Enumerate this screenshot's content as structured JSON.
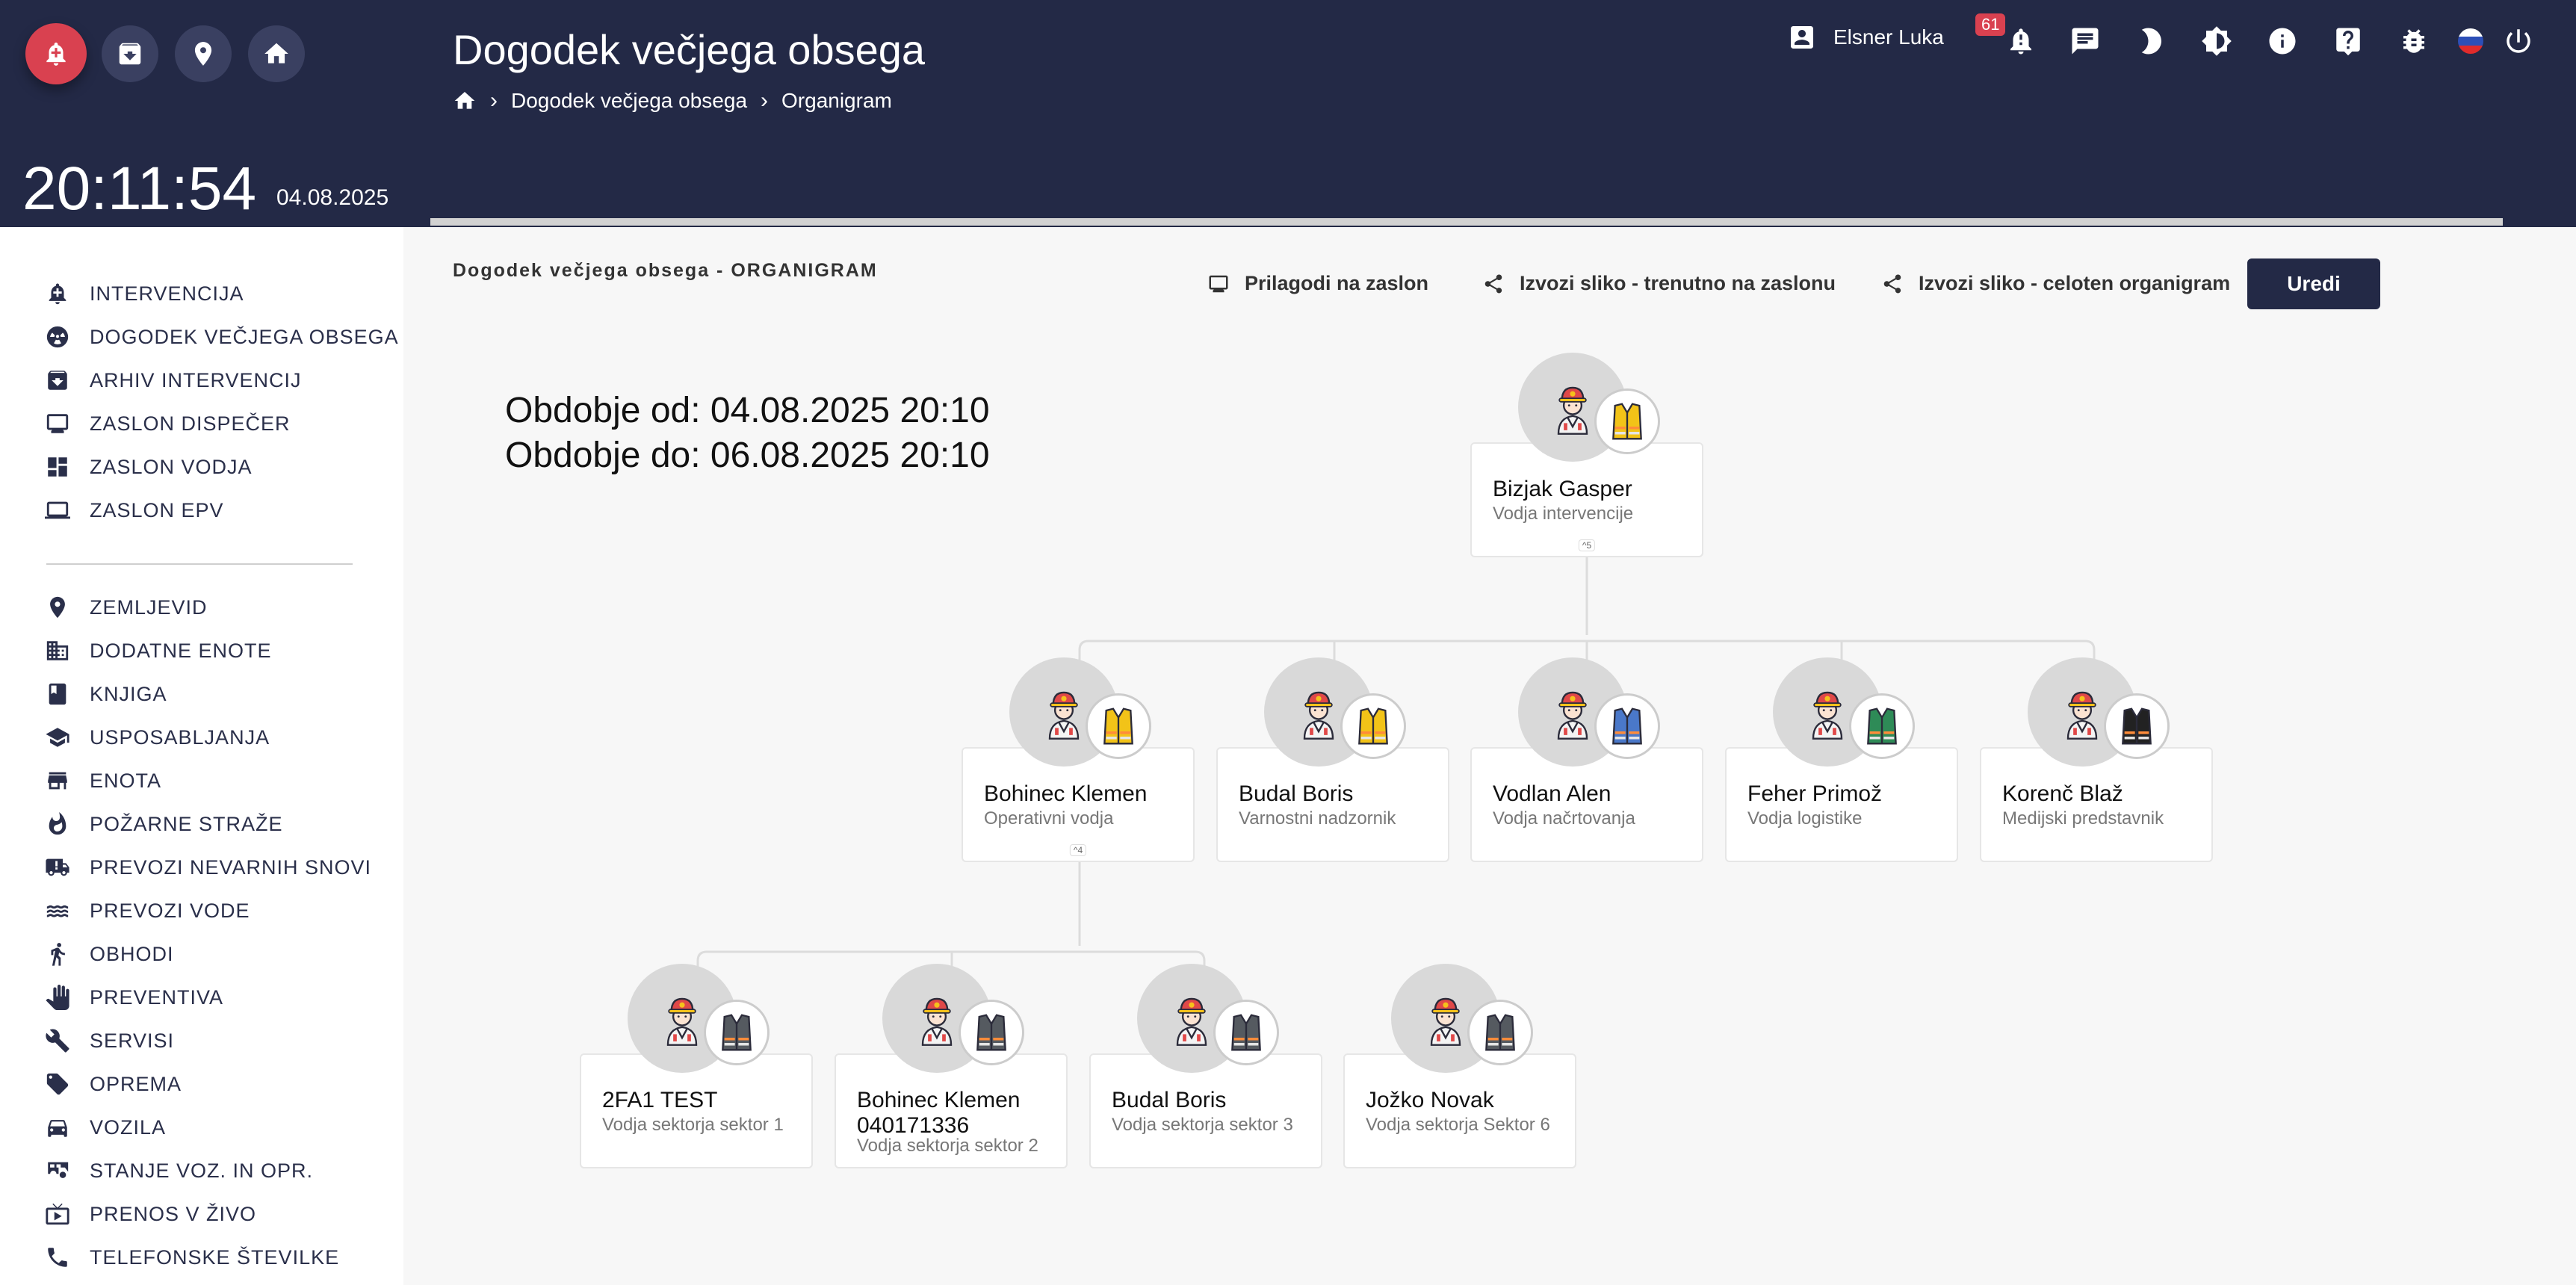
{
  "header": {
    "title": "Dogodek večjega obsega",
    "breadcrumb": [
      "Dogodek večjega obsega",
      "Organigram"
    ],
    "clock": "20:11:54",
    "date": "04.08.2025",
    "user_name": "Elsner Luka",
    "notification_count": "61",
    "top_buttons": [
      "alarm-add-icon",
      "archive-icon",
      "location-icon",
      "home-icon"
    ],
    "top_icons": [
      "bell-icon",
      "chat-icon",
      "dark-mode-icon",
      "brightness-icon",
      "info-icon",
      "help-icon",
      "bug-icon",
      "slovenian-flag-icon",
      "power-icon"
    ]
  },
  "sidebar": {
    "items": [
      {
        "label": "INTERVENCIJA",
        "icon": "bell-plus-icon"
      },
      {
        "label": "DOGODEK VEČJEGA OBSEGA",
        "icon": "radioactive-icon"
      },
      {
        "label": "ARHIV INTERVENCIJ",
        "icon": "archive-icon"
      },
      {
        "label": "ZASLON DISPEČER",
        "icon": "monitor-icon"
      },
      {
        "label": "ZASLON VODJA",
        "icon": "dashboard-icon"
      },
      {
        "label": "ZASLON EPV",
        "icon": "laptop-icon"
      },
      {
        "label": "ZEMLJEVID",
        "icon": "location-icon"
      },
      {
        "label": "DODATNE ENOTE",
        "icon": "building-icon"
      },
      {
        "label": "KNJIGA",
        "icon": "book-icon"
      },
      {
        "label": "USPOSABLJANJA",
        "icon": "school-icon"
      },
      {
        "label": "ENOTA",
        "icon": "store-icon"
      },
      {
        "label": "POŽARNE STRAŽE",
        "icon": "fire-icon"
      },
      {
        "label": "PREVOZI NEVARNIH SNOVI",
        "icon": "truck-alert-icon"
      },
      {
        "label": "PREVOZI VODE",
        "icon": "water-waves-icon"
      },
      {
        "label": "OBHODI",
        "icon": "walk-icon"
      },
      {
        "label": "PREVENTIVA",
        "icon": "hand-icon"
      },
      {
        "label": "SERVISI",
        "icon": "wrench-icon"
      },
      {
        "label": "OPREMA",
        "icon": "tag-icon"
      },
      {
        "label": "VOZILA",
        "icon": "car-icon"
      },
      {
        "label": "STANJE VOZ. IN OPR.",
        "icon": "rv-icon"
      },
      {
        "label": "PRENOS V ŽIVO",
        "icon": "live-tv-icon"
      },
      {
        "label": "TELEFONSKE ŠTEVILKE",
        "icon": "phone-icon"
      }
    ]
  },
  "main": {
    "section_title": "Dogodek večjega obsega - ORGANIGRAM",
    "tools": [
      "Prilagodi na zaslon",
      "Izvozi sliko - trenutno na zaslonu",
      "Izvozi sliko - celoten organigram"
    ],
    "edit_label": "Uredi",
    "period_from": "Obdobje od: 04.08.2025 20:10",
    "period_to": "Obdobje do: 06.08.2025 20:10"
  },
  "org": {
    "root": {
      "name": "Bizjak Gasper",
      "role": "Vodja intervencije",
      "children_count": "5",
      "vest_color": "#f2c318"
    },
    "level2": [
      {
        "name": "Bohinec Klemen",
        "role": "Operativni vodja",
        "children_count": "4",
        "vest_color": "#f2c318"
      },
      {
        "name": "Budal Boris",
        "role": "Varnostni nadzornik",
        "vest_color": "#f2c318"
      },
      {
        "name": "Vodlan Alen",
        "role": "Vodja načrtovanja",
        "vest_color": "#4a78c9"
      },
      {
        "name": "Feher Primož",
        "role": "Vodja logistike",
        "vest_color": "#2e8b57"
      },
      {
        "name": "Korenč Blaž",
        "role": "Medijski predstavnik",
        "vest_color": "#222222"
      }
    ],
    "level3": [
      {
        "name": "2FA1 TEST",
        "role": "Vodja sektorja sektor 1",
        "vest_color": "#555a60"
      },
      {
        "name": "Bohinec Klemen 040171336",
        "role": "Vodja sektorja sektor 2",
        "vest_color": "#555a60"
      },
      {
        "name": "Budal Boris",
        "role": "Vodja sektorja sektor 3",
        "vest_color": "#555a60"
      },
      {
        "name": "Jožko Novak",
        "role": "Vodja sektorja Sektor 6",
        "vest_color": "#555a60"
      }
    ]
  }
}
